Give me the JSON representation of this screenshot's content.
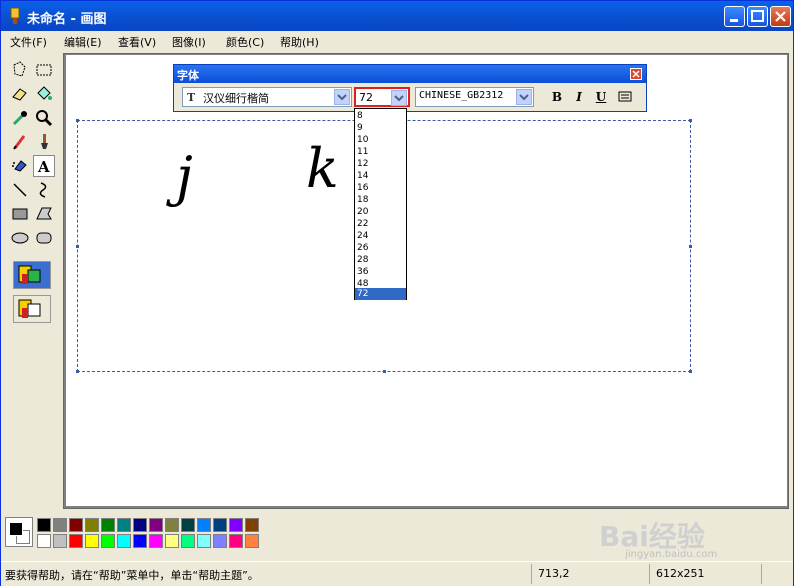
{
  "window": {
    "title": "未命名 - 画图"
  },
  "menu": [
    "文件(F)",
    "编辑(E)",
    "查看(V)",
    "图像(I)",
    "颜色(C)",
    "帮助(H)"
  ],
  "toolbox": {
    "tools": [
      "free-select",
      "rect-select",
      "eraser",
      "fill",
      "color-picker",
      "magnifier",
      "pencil",
      "brush",
      "airbrush",
      "text",
      "line",
      "curve",
      "rectangle",
      "polygon",
      "ellipse",
      "rounded-rectangle"
    ],
    "selected": "text"
  },
  "canvas": {
    "letters": [
      "j",
      "k"
    ]
  },
  "font_toolbar": {
    "title": "字体",
    "font_name": "汉仪细行楷简",
    "font_size": "72",
    "script": "CHINESE_GB2312",
    "bold": "B",
    "italic": "I",
    "underline": "U"
  },
  "size_options": [
    "8",
    "9",
    "10",
    "11",
    "12",
    "14",
    "16",
    "18",
    "20",
    "22",
    "24",
    "26",
    "28",
    "36",
    "48",
    "72"
  ],
  "selected_size": "72",
  "palette": {
    "top": [
      "#000000",
      "#808080",
      "#800000",
      "#808000",
      "#008000",
      "#008080",
      "#000080",
      "#800080",
      "#808040",
      "#004040",
      "#0080FF",
      "#004080",
      "#8000FF",
      "#804000"
    ],
    "bottom": [
      "#FFFFFF",
      "#C0C0C0",
      "#FF0000",
      "#FFFF00",
      "#00FF00",
      "#00FFFF",
      "#0000FF",
      "#FF00FF",
      "#FFFF80",
      "#00FF80",
      "#80FFFF",
      "#8080FF",
      "#FF0080",
      "#FF8040"
    ]
  },
  "status": {
    "help": "要获得帮助，请在“帮助”菜单中，单击“帮助主题”。",
    "coords": "713,2",
    "size": "612x251"
  },
  "watermark": {
    "text": "Bai经验",
    "url": "jingyan.baidu.com"
  }
}
